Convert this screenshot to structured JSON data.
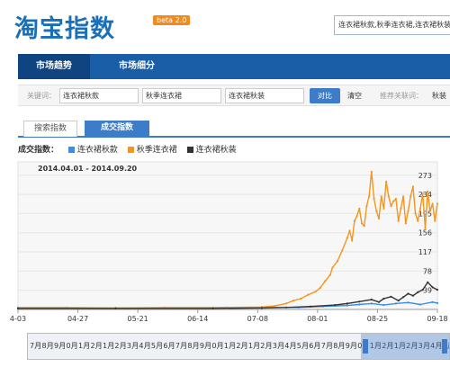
{
  "header": {
    "logo": "淘宝指数",
    "beta": "beta 2.0",
    "search_value": "连衣裙秋款,秋季连衣裙,连衣裙秋装"
  },
  "nav": {
    "tabs": [
      {
        "label": "市场趋势",
        "active": true
      },
      {
        "label": "市场细分",
        "active": false
      }
    ]
  },
  "keywords": {
    "label": "关键词：",
    "values": [
      "连衣裙秋款",
      "秋季连衣裙",
      "连衣裙秋装"
    ],
    "compare": "对比",
    "clear": "清空",
    "recommend_label": "推荐关联词：",
    "recommend_item": "秋装"
  },
  "subtabs": [
    {
      "label": "搜索指数",
      "active": false
    },
    {
      "label": "成交指数",
      "active": true
    }
  ],
  "legend": {
    "label": "成交指数：",
    "items": [
      {
        "name": "连衣裙秋款",
        "color": "#3a8ee6"
      },
      {
        "name": "秋季连衣裙",
        "color": "#f3961e"
      },
      {
        "name": "连衣裙秋装",
        "color": "#333333"
      }
    ]
  },
  "chart_data": {
    "type": "line",
    "date_range": "2014.04.01 - 2014.09.20",
    "x_ticks": [
      "4-03",
      "04-27",
      "05-21",
      "06-14",
      "07-08",
      "08-01",
      "08-25",
      "09-18"
    ],
    "y_ticks": [
      39,
      78,
      117,
      156,
      195,
      234,
      273
    ],
    "ylim": [
      0,
      300
    ],
    "days": 173,
    "series": [
      {
        "name": "连衣裙秋款",
        "color": "#3a8ee6",
        "points": [
          [
            0,
            3
          ],
          [
            40,
            3
          ],
          [
            80,
            3
          ],
          [
            100,
            4
          ],
          [
            115,
            4
          ],
          [
            125,
            6
          ],
          [
            135,
            8
          ],
          [
            140,
            10
          ],
          [
            145,
            12
          ],
          [
            150,
            9
          ],
          [
            155,
            12
          ],
          [
            160,
            14
          ],
          [
            165,
            10
          ],
          [
            170,
            15
          ],
          [
            172,
            13
          ]
        ]
      },
      {
        "name": "秋季连衣裙",
        "color": "#f3961e",
        "points": [
          [
            0,
            4
          ],
          [
            20,
            4
          ],
          [
            40,
            3
          ],
          [
            60,
            4
          ],
          [
            80,
            4
          ],
          [
            100,
            5
          ],
          [
            105,
            7
          ],
          [
            110,
            12
          ],
          [
            113,
            18
          ],
          [
            116,
            22
          ],
          [
            119,
            30
          ],
          [
            122,
            36
          ],
          [
            124,
            44
          ],
          [
            126,
            58
          ],
          [
            128,
            70
          ],
          [
            129,
            85
          ],
          [
            131,
            98
          ],
          [
            133,
            120
          ],
          [
            135,
            145
          ],
          [
            136,
            160
          ],
          [
            137,
            140
          ],
          [
            138,
            180
          ],
          [
            139,
            190
          ],
          [
            140,
            205
          ],
          [
            141,
            175
          ],
          [
            142,
            170
          ],
          [
            143,
            210
          ],
          [
            144,
            230
          ],
          [
            145,
            280
          ],
          [
            146,
            225
          ],
          [
            147,
            200
          ],
          [
            148,
            185
          ],
          [
            149,
            230
          ],
          [
            150,
            205
          ],
          [
            151,
            260
          ],
          [
            152,
            230
          ],
          [
            153,
            210
          ],
          [
            154,
            220
          ],
          [
            155,
            225
          ],
          [
            156,
            180
          ],
          [
            157,
            205
          ],
          [
            158,
            230
          ],
          [
            159,
            175
          ],
          [
            160,
            200
          ],
          [
            161,
            230
          ],
          [
            162,
            250
          ],
          [
            163,
            195
          ],
          [
            164,
            180
          ],
          [
            165,
            205
          ],
          [
            166,
            235
          ],
          [
            167,
            165
          ],
          [
            168,
            240
          ],
          [
            169,
            200
          ],
          [
            170,
            215
          ],
          [
            171,
            180
          ],
          [
            172,
            215
          ]
        ]
      },
      {
        "name": "连衣裙秋装",
        "color": "#333333",
        "points": [
          [
            0,
            2
          ],
          [
            40,
            2
          ],
          [
            80,
            2
          ],
          [
            100,
            3
          ],
          [
            110,
            4
          ],
          [
            120,
            6
          ],
          [
            130,
            9
          ],
          [
            135,
            12
          ],
          [
            140,
            16
          ],
          [
            145,
            20
          ],
          [
            148,
            15
          ],
          [
            150,
            22
          ],
          [
            153,
            26
          ],
          [
            156,
            18
          ],
          [
            158,
            25
          ],
          [
            160,
            32
          ],
          [
            162,
            28
          ],
          [
            164,
            35
          ],
          [
            166,
            40
          ],
          [
            168,
            55
          ],
          [
            170,
            45
          ],
          [
            172,
            40
          ]
        ]
      }
    ]
  },
  "timeline": {
    "label": "7月8月9月0月1月2月1月2月3月4月5月6月7月8月9月0月1月2月1月2月3月4月5月6月7月8月9月0月1月2月1月2月3月4月5月6月7月8月9月"
  }
}
